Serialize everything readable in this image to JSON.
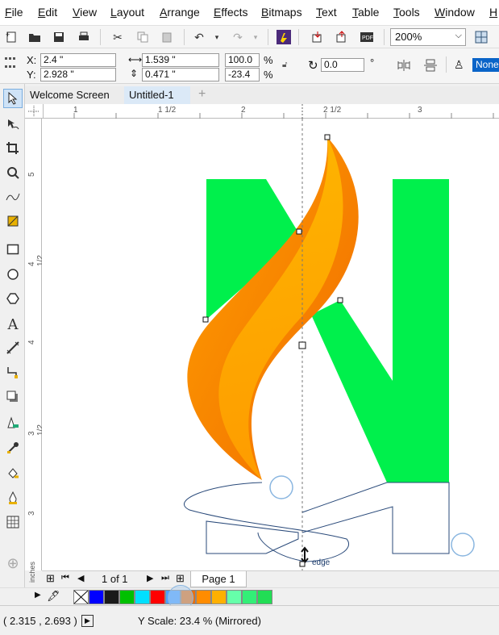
{
  "menu": [
    "File",
    "Edit",
    "View",
    "Layout",
    "Arrange",
    "Effects",
    "Bitmaps",
    "Text",
    "Table",
    "Tools",
    "Window",
    "H"
  ],
  "toolbar": {
    "zoom": "200%",
    "buttons": [
      "new-icon",
      "open-icon",
      "save-icon",
      "print-icon",
      "cut-icon",
      "copy-icon",
      "paste-icon",
      "undo-icon",
      "redo-icon",
      "corel-connect-icon",
      "import-icon",
      "export-icon",
      "publish-pdf-icon",
      "snap-to-icon"
    ]
  },
  "propbar": {
    "x_label": "X:",
    "x_value": "2.4 \"",
    "y_label": "Y:",
    "y_value": "2.928 \"",
    "w_value": "1.539 \"",
    "h_value": "0.471 \"",
    "sx_value": "100.0",
    "sy_value": "-23.4",
    "pct": "%",
    "rotation_value": "0.0",
    "degree": "°",
    "outline_value": "None"
  },
  "tabs": {
    "welcome": "Welcome Screen",
    "doc": "Untitled-1",
    "add": "+"
  },
  "ruler": {
    "top_ticks": [
      "1",
      "1 1/2",
      "2",
      "2 1/2",
      "3"
    ],
    "left_ticks": [
      "5",
      "4 1/2",
      "4",
      "3 1/2",
      "3"
    ],
    "units": "inches"
  },
  "canvas": {
    "cursor_label": "edge"
  },
  "pagenav": {
    "count": "1 of 1",
    "page_tab": "Page 1"
  },
  "palette": {
    "colors": [
      "#0000ff",
      "#1a1a1a",
      "#00c000",
      "#00e0ff",
      "#ff0000",
      "#4da0ff",
      "#e87010",
      "#ff8c00",
      "#ffb000",
      "#66ffaa",
      "#33ee77",
      "#22dd55"
    ]
  },
  "status": {
    "coords": "( 2.315 , 2.693 )",
    "message": "Y Scale: 23.4 % (Mirrored)"
  },
  "colors": {
    "logo_green": "#00f04c",
    "flame_dark": "#f07800",
    "flame_light": "#ffb000",
    "accent": "#0066cc"
  }
}
